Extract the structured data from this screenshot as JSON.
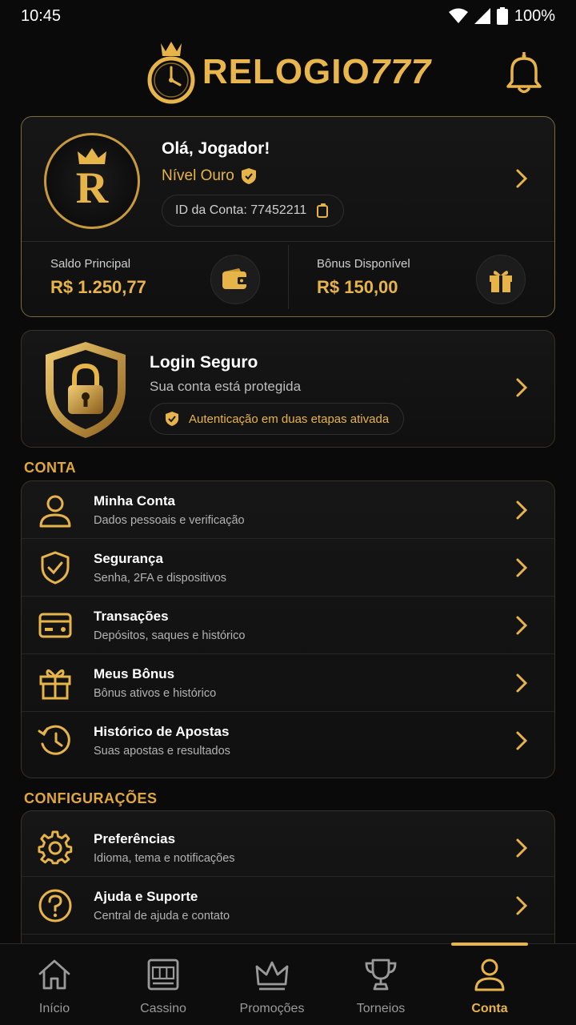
{
  "status_bar": {
    "time": "10:45",
    "battery": "100%"
  },
  "brand": {
    "name": "RELOGIO",
    "number": "777"
  },
  "profile": {
    "greeting": "Olá, Jogador!",
    "level": "Nível Ouro",
    "avatar_letter": "R",
    "account_id": "ID da Conta: 77452211",
    "main_balance_label": "Saldo Principal",
    "main_balance_value": "R$ 1.250,77",
    "bonus_label": "Bônus Disponível",
    "bonus_value": "R$ 150,00"
  },
  "security": {
    "title": "Login Seguro",
    "subtitle": "Sua conta está protegida",
    "twofa": "Autenticação em duas etapas ativada"
  },
  "sections": {
    "account_title": "CONTA",
    "config_title": "CONFIGURAÇÕES"
  },
  "account_menu": [
    {
      "title": "Minha Conta",
      "subtitle": "Dados pessoais e verificação",
      "icon": "user-icon"
    },
    {
      "title": "Segurança",
      "subtitle": "Senha, 2FA e dispositivos",
      "icon": "shield-check-icon"
    },
    {
      "title": "Transações",
      "subtitle": "Depósitos, saques e histórico",
      "icon": "card-icon"
    },
    {
      "title": "Meus Bônus",
      "subtitle": "Bônus ativos e histórico",
      "icon": "gift-icon"
    },
    {
      "title": "Histórico de Apostas",
      "subtitle": "Suas apostas e resultados",
      "icon": "history-icon"
    }
  ],
  "config_menu": [
    {
      "title": "Preferências",
      "subtitle": "Idioma, tema e notificações",
      "icon": "gear-icon"
    },
    {
      "title": "Ajuda e Suporte",
      "subtitle": "Central de ajuda e contato",
      "icon": "help-icon"
    }
  ],
  "bottom_nav": [
    {
      "label": "Início",
      "icon": "home-icon"
    },
    {
      "label": "Cassino",
      "icon": "slot-machine-icon"
    },
    {
      "label": "Promoções",
      "icon": "crown-icon"
    },
    {
      "label": "Torneios",
      "icon": "trophy-icon"
    },
    {
      "label": "Conta",
      "icon": "user-icon",
      "active": true
    }
  ],
  "colors": {
    "accent": "#e7b44a",
    "background": "#0a0a0a",
    "card": "#141414"
  }
}
